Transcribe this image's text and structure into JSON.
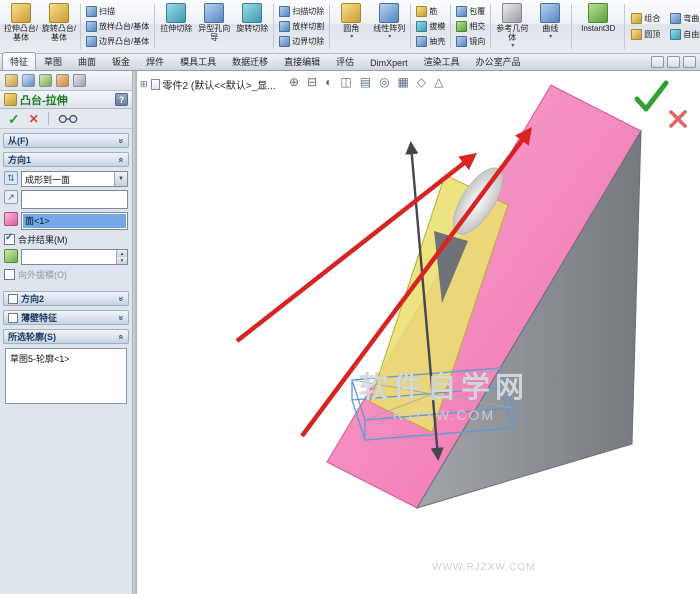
{
  "ribbon": {
    "groups": [
      {
        "items": [
          {
            "label": "拉伸凸台/基体"
          },
          {
            "label": "旋转凸台/基体"
          }
        ]
      },
      {
        "items": [
          {
            "label": "扫描"
          },
          {
            "label": "放样凸台/基体"
          },
          {
            "label": "边界凸台/基体"
          }
        ]
      },
      {
        "items": [
          {
            "label": "拉伸切除"
          },
          {
            "label": "异型孔向导"
          },
          {
            "label": "旋转切除"
          }
        ]
      },
      {
        "items": [
          {
            "label": "扫描切除"
          },
          {
            "label": "放样切割"
          },
          {
            "label": "边界切除"
          }
        ]
      },
      {
        "items": [
          {
            "label": "圆角"
          },
          {
            "label": "线性阵列"
          }
        ]
      },
      {
        "items": [
          {
            "label": "筋"
          },
          {
            "label": "拔模"
          },
          {
            "label": "抽壳"
          }
        ]
      },
      {
        "items": [
          {
            "label": "包覆"
          },
          {
            "label": "相交"
          },
          {
            "label": "镜向"
          }
        ]
      },
      {
        "items": [
          {
            "label": "参考几何体"
          },
          {
            "label": "曲线"
          }
        ]
      },
      {
        "items": [
          {
            "label": "Instant3D"
          }
        ]
      },
      {
        "items": [
          {
            "label": "组合"
          },
          {
            "label": "弯曲"
          },
          {
            "label": "圆顶"
          },
          {
            "label": "自由形"
          }
        ]
      }
    ]
  },
  "tabbar": {
    "tabs": [
      {
        "label": "特征"
      },
      {
        "label": "草图"
      },
      {
        "label": "曲面"
      },
      {
        "label": "钣金"
      },
      {
        "label": "焊件"
      },
      {
        "label": "模具工具"
      },
      {
        "label": "数据迁移"
      },
      {
        "label": "直接编辑"
      },
      {
        "label": "评估"
      },
      {
        "label": "DimXpert"
      },
      {
        "label": "渲染工具"
      },
      {
        "label": "办公室产品"
      }
    ]
  },
  "panel": {
    "title": "凸台-拉伸",
    "help_label": "?",
    "from_section": "从(F)",
    "dir1_section": "方向1",
    "dir2_section": "方向2",
    "thin_section": "薄壁特征",
    "profiles_section": "所选轮廓(S)",
    "end_condition": "成形到一面",
    "face_reference": "面<1>",
    "merge_result_label": "合并结果(M)",
    "draft_value": "",
    "outward_draft_label": "向外拔模(O)",
    "profile_item": "草图5-轮廓<1>"
  },
  "viewport": {
    "doc_title": "零件2 (默认<<默认>_显...",
    "watermark_title": "软件自学网",
    "watermark_sub": "RJZXW.COM",
    "watermark_footer": "WWW.RJZXW.COM"
  },
  "colors": {
    "selected_face_pink": "#f28abe",
    "preview_yellow": "#e9e070",
    "sketch_blue": "#5b9bd5",
    "annotation_red": "#d92323",
    "confirm_green": "#2fa12f",
    "cancel_red": "#e26565"
  }
}
